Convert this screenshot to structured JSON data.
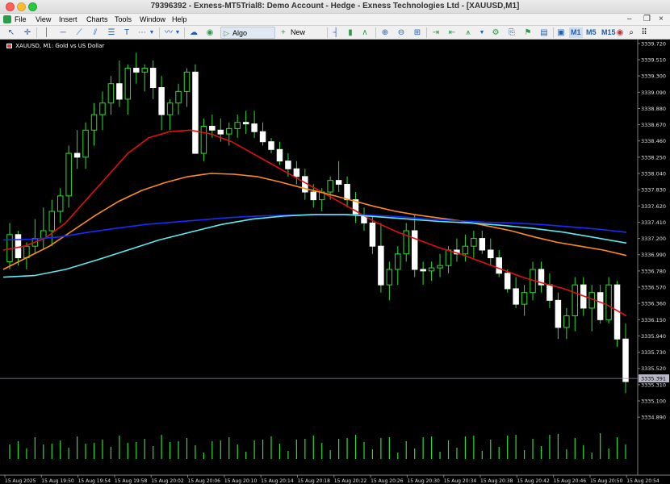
{
  "window": {
    "title": "79396392 - Exness-MT5Trial8: Demo Account - Hedge - Exness Technologies Ltd - [XAUUSD,M1]"
  },
  "menu": [
    "File",
    "View",
    "Insert",
    "Charts",
    "Tools",
    "Window",
    "Help"
  ],
  "toolbar": {
    "algo_trading_label": "Algo Trading",
    "new_order_label": "New Order",
    "timeframes": [
      "M1",
      "M5",
      "M15"
    ],
    "active_timeframe": "M1"
  },
  "chart": {
    "symbol_label": "XAUUSD, M1:  Gold vs US Dollar",
    "current_price": "3335.391"
  },
  "chart_data": {
    "type": "candlestick",
    "symbol": "XAUUSD",
    "timeframe": "M1",
    "y_ticks": [
      "3339.720",
      "3339.510",
      "3339.300",
      "3339.090",
      "3338.880",
      "3338.670",
      "3338.460",
      "3338.250",
      "3338.040",
      "3337.830",
      "3337.620",
      "3337.410",
      "3337.200",
      "3336.990",
      "3336.780",
      "3336.570",
      "3336.360",
      "3336.150",
      "3335.940",
      "3335.730",
      "3335.520",
      "3335.310",
      "3335.100",
      "3334.890"
    ],
    "x_ticks": [
      "15 Aug 2025",
      "15 Aug 19:50",
      "15 Aug 19:54",
      "15 Aug 19:58",
      "15 Aug 20:02",
      "15 Aug 20:06",
      "15 Aug 20:10",
      "15 Aug 20:14",
      "15 Aug 20:18",
      "15 Aug 20:22",
      "15 Aug 20:26",
      "15 Aug 20:30",
      "15 Aug 20:34",
      "15 Aug 20:38",
      "15 Aug 20:42",
      "15 Aug 20:46",
      "15 Aug 20:50",
      "15 Aug 20:54"
    ],
    "ylim": [
      3334.85,
      3339.75
    ],
    "candles": [
      [
        3336.9,
        3337.4,
        3336.8,
        3337.25
      ],
      [
        3337.25,
        3337.3,
        3336.85,
        3336.95
      ],
      [
        3336.95,
        3337.15,
        3336.8,
        3337.1
      ],
      [
        3337.1,
        3337.45,
        3337.0,
        3337.2
      ],
      [
        3337.2,
        3337.6,
        3337.05,
        3337.3
      ],
      [
        3337.3,
        3337.7,
        3337.1,
        3337.55
      ],
      [
        3337.55,
        3337.85,
        3337.4,
        3337.75
      ],
      [
        3337.75,
        3338.4,
        3337.6,
        3338.3
      ],
      [
        3338.3,
        3338.6,
        3338.1,
        3338.25
      ],
      [
        3338.25,
        3338.7,
        3338.1,
        3338.6
      ],
      [
        3338.6,
        3338.95,
        3338.4,
        3338.8
      ],
      [
        3338.8,
        3339.1,
        3338.6,
        3338.95
      ],
      [
        3338.95,
        3339.3,
        3338.8,
        3339.2
      ],
      [
        3339.2,
        3339.5,
        3338.9,
        3339.0
      ],
      [
        3339.0,
        3339.45,
        3338.8,
        3339.4
      ],
      [
        3339.4,
        3339.6,
        3339.2,
        3339.35
      ],
      [
        3339.35,
        3339.45,
        3339.1,
        3339.4
      ],
      [
        3339.4,
        3339.5,
        3339.0,
        3339.15
      ],
      [
        3339.15,
        3339.3,
        3338.6,
        3338.8
      ],
      [
        3338.8,
        3339.0,
        3338.6,
        3338.95
      ],
      [
        3338.95,
        3339.2,
        3338.8,
        3339.1
      ],
      [
        3339.1,
        3339.4,
        3338.9,
        3339.35
      ],
      [
        3339.35,
        3339.45,
        3338.4,
        3338.3
      ],
      [
        3338.3,
        3338.75,
        3338.2,
        3338.65
      ],
      [
        3338.65,
        3338.8,
        3338.5,
        3338.6
      ],
      [
        3338.6,
        3338.75,
        3338.45,
        3338.55
      ],
      [
        3338.55,
        3338.7,
        3338.4,
        3338.62
      ],
      [
        3338.62,
        3338.8,
        3338.5,
        3338.7
      ],
      [
        3338.7,
        3338.85,
        3338.55,
        3338.68
      ],
      [
        3338.68,
        3338.85,
        3338.5,
        3338.58
      ],
      [
        3338.58,
        3338.7,
        3338.4,
        3338.45
      ],
      [
        3338.45,
        3338.5,
        3338.3,
        3338.35
      ],
      [
        3338.35,
        3338.45,
        3338.15,
        3338.2
      ],
      [
        3338.2,
        3338.3,
        3338.0,
        3338.1
      ],
      [
        3338.1,
        3338.2,
        3337.9,
        3338.0
      ],
      [
        3338.0,
        3338.1,
        3337.7,
        3337.8
      ],
      [
        3337.8,
        3337.9,
        3337.6,
        3337.7
      ],
      [
        3337.7,
        3337.85,
        3337.55,
        3337.8
      ],
      [
        3337.8,
        3338.0,
        3337.7,
        3337.95
      ],
      [
        3337.95,
        3338.2,
        3337.8,
        3337.9
      ],
      [
        3337.9,
        3338.0,
        3337.6,
        3337.7
      ],
      [
        3337.7,
        3337.8,
        3337.4,
        3337.5
      ],
      [
        3337.5,
        3337.6,
        3337.3,
        3337.4
      ],
      [
        3337.4,
        3337.5,
        3337.0,
        3337.1
      ],
      [
        3337.1,
        3337.4,
        3336.5,
        3336.6
      ],
      [
        3336.6,
        3336.9,
        3336.4,
        3336.8
      ],
      [
        3336.8,
        3337.1,
        3336.6,
        3337.0
      ],
      [
        3337.0,
        3337.4,
        3336.9,
        3337.3
      ],
      [
        3337.3,
        3337.5,
        3336.7,
        3336.8
      ],
      [
        3336.8,
        3336.9,
        3336.6,
        3336.78
      ],
      [
        3336.78,
        3336.9,
        3336.65,
        3336.82
      ],
      [
        3336.82,
        3337.0,
        3336.7,
        3336.85
      ],
      [
        3336.85,
        3337.1,
        3336.75,
        3337.05
      ],
      [
        3337.05,
        3337.2,
        3336.9,
        3337.0
      ],
      [
        3337.0,
        3337.25,
        3336.9,
        3337.1
      ],
      [
        3337.1,
        3337.3,
        3336.95,
        3337.2
      ],
      [
        3337.2,
        3337.3,
        3337.0,
        3337.05
      ],
      [
        3337.05,
        3337.2,
        3336.85,
        3336.95
      ],
      [
        3336.95,
        3337.05,
        3336.7,
        3336.75
      ],
      [
        3336.75,
        3336.8,
        3336.5,
        3336.55
      ],
      [
        3336.55,
        3336.7,
        3336.3,
        3336.35
      ],
      [
        3336.35,
        3336.6,
        3336.2,
        3336.5
      ],
      [
        3336.5,
        3336.9,
        3336.4,
        3336.8
      ],
      [
        3336.8,
        3336.9,
        3336.5,
        3336.6
      ],
      [
        3336.6,
        3336.75,
        3336.3,
        3336.4
      ],
      [
        3336.4,
        3336.5,
        3335.9,
        3336.05
      ],
      [
        3336.05,
        3336.3,
        3335.9,
        3336.2
      ],
      [
        3336.2,
        3336.7,
        3336.0,
        3336.6
      ],
      [
        3336.6,
        3336.7,
        3336.2,
        3336.3
      ],
      [
        3336.3,
        3336.6,
        3336.0,
        3336.5
      ],
      [
        3336.5,
        3336.6,
        3336.1,
        3336.15
      ],
      [
        3336.15,
        3336.7,
        3336.1,
        3336.6
      ],
      [
        3336.6,
        3336.65,
        3335.8,
        3335.9
      ],
      [
        3335.9,
        3336.1,
        3335.2,
        3335.35
      ]
    ],
    "moving_averages": [
      {
        "color": "#e01010",
        "values": [
          3337.05,
          3337.1,
          3337.2,
          3337.4,
          3337.7,
          3338.0,
          3338.3,
          3338.5,
          3338.58,
          3338.6,
          3338.55,
          3338.45,
          3338.3,
          3338.15,
          3338.0,
          3337.85,
          3337.7,
          3337.55,
          3337.4,
          3337.28,
          3337.18,
          3337.08,
          3337.0,
          3336.9,
          3336.8,
          3336.7,
          3336.62,
          3336.55,
          3336.45,
          3336.35,
          3336.2
        ]
      },
      {
        "color": "#ff8c1a",
        "values": [
          3336.8,
          3336.95,
          3337.1,
          3337.3,
          3337.5,
          3337.68,
          3337.82,
          3337.92,
          3338.0,
          3338.04,
          3338.03,
          3338.0,
          3337.93,
          3337.85,
          3337.78,
          3337.7,
          3337.62,
          3337.55,
          3337.5,
          3337.46,
          3337.42,
          3337.36,
          3337.3,
          3337.22,
          3337.15,
          3337.1,
          3337.05,
          3336.98
        ]
      },
      {
        "color": "#1a2aff",
        "values": [
          3337.18,
          3337.19,
          3337.22,
          3337.28,
          3337.33,
          3337.38,
          3337.41,
          3337.44,
          3337.47,
          3337.49,
          3337.5,
          3337.51,
          3337.51,
          3337.5,
          3337.48,
          3337.45,
          3337.43,
          3337.41,
          3337.4,
          3337.38,
          3337.35,
          3337.32,
          3337.28
        ]
      },
      {
        "color": "#60e8f0",
        "values": [
          3336.7,
          3336.72,
          3336.8,
          3336.92,
          3337.05,
          3337.18,
          3337.28,
          3337.38,
          3337.45,
          3337.49,
          3337.51,
          3337.51,
          3337.48,
          3337.45,
          3337.42,
          3337.4,
          3337.37,
          3337.33,
          3337.28,
          3337.21,
          3337.14
        ]
      }
    ]
  }
}
